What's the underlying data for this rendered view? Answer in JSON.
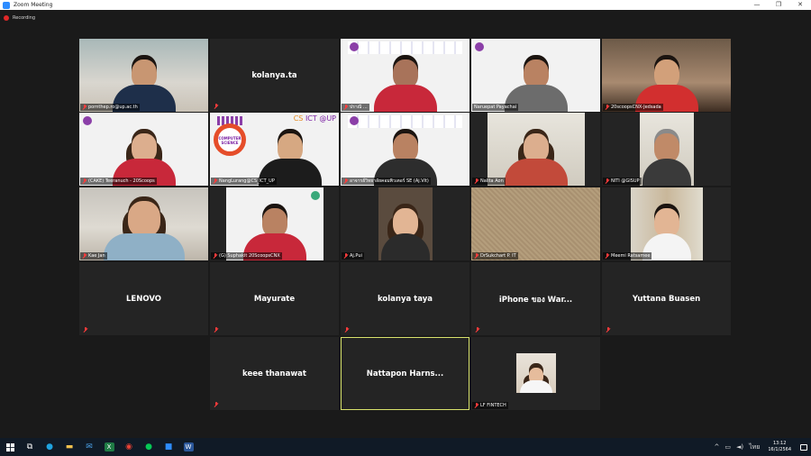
{
  "window": {
    "title": "Zoom Meeting",
    "controls": [
      "—",
      "❐",
      "✕"
    ]
  },
  "recording": {
    "label": "Recording",
    "color": "#e02828"
  },
  "active_speaker_color": "#d8e26c",
  "tiles": [
    {
      "id": "pornthep",
      "caption": "pornthep.ro@up.ac.th",
      "muted": true,
      "video": true
    },
    {
      "id": "kolanya-ta",
      "name": "kolanya.ta",
      "muted": true,
      "video": false
    },
    {
      "id": "chiangmai",
      "caption": "ปราณี ...",
      "muted": true,
      "video": true
    },
    {
      "id": "naruepat",
      "caption": "Naruepat Payachai",
      "muted": false,
      "video": true
    },
    {
      "id": "jedsada",
      "caption": "20scoopsCNX-Jedsada",
      "muted": true,
      "video": true
    },
    {
      "id": "teeranuch",
      "caption": "(CAKE) Teeranuch - 20Scoops",
      "muted": true,
      "video": true
    },
    {
      "id": "nangurang",
      "caption": "NangLurang@CS_ICT_UP",
      "muted": true,
      "video": true,
      "tag_cs": "CS",
      "tag_ict": "ICT @UP",
      "logo_text": "COMPUTER SCIENCE"
    },
    {
      "id": "ajvit",
      "caption": "อาจารย์วิทยาลัยคอมพิวเตอร์ SE (Aj.Vit)",
      "muted": true,
      "video": true
    },
    {
      "id": "nalita",
      "caption": "Nalita Aon",
      "muted": true,
      "video": true
    },
    {
      "id": "niti",
      "caption": "NITI @GISUP",
      "muted": true,
      "video": true
    },
    {
      "id": "kae-jan",
      "caption": "Kae Jan",
      "muted": true,
      "video": true
    },
    {
      "id": "suphakit",
      "caption": "(G) Suphakit 20ScoopsCNX",
      "muted": true,
      "video": true
    },
    {
      "id": "aj-pui",
      "caption": "Aj.Pui",
      "muted": true,
      "video": true
    },
    {
      "id": "sukchart",
      "caption": "DrSukchart P. IT",
      "muted": true,
      "video": true
    },
    {
      "id": "meemi",
      "caption": "Meemi Ratsamee",
      "muted": true,
      "video": true
    },
    {
      "id": "lenovo",
      "name": "LENOVO",
      "muted": true,
      "video": false
    },
    {
      "id": "mayurate",
      "name": "Mayurate",
      "muted": true,
      "video": false
    },
    {
      "id": "kolanya-taya",
      "name": "kolanya taya",
      "muted": true,
      "video": false
    },
    {
      "id": "iphone-war",
      "name": "iPhone ของ War...",
      "muted": true,
      "video": false
    },
    {
      "id": "yuttana",
      "name": "Yuttana Buasen",
      "muted": true,
      "video": false
    },
    {
      "id": "keee",
      "name": "keee thanawat",
      "muted": true,
      "video": false
    },
    {
      "id": "nattapon",
      "name": "Nattapon  Harns...",
      "muted": false,
      "video": false,
      "active": true
    },
    {
      "id": "lf-fintech",
      "caption": "LF FINTECH",
      "muted": true,
      "video": true
    }
  ],
  "taskbar": {
    "start_icon": "windows-start-icon",
    "apps": [
      {
        "name": "task-view-icon",
        "glyph": "⧉",
        "color": "#ffffff"
      },
      {
        "name": "edge-browser-icon",
        "glyph": "●",
        "color": "#1fa3e0"
      },
      {
        "name": "file-explorer-icon",
        "glyph": "▬",
        "color": "#f2c14e"
      },
      {
        "name": "mail-icon",
        "glyph": "✉",
        "color": "#4aa0e6"
      },
      {
        "name": "excel-icon",
        "glyph": "X",
        "color": "#1f7b45"
      },
      {
        "name": "chrome-icon",
        "glyph": "◉",
        "color": "#e94235"
      },
      {
        "name": "line-icon",
        "glyph": "●",
        "color": "#06c755"
      },
      {
        "name": "zoom-icon",
        "glyph": "■",
        "color": "#2d8cff"
      },
      {
        "name": "word-icon",
        "glyph": "W",
        "color": "#2b579a"
      }
    ],
    "tray": {
      "chevron": "^",
      "ime": "ไทย",
      "time": "13:12",
      "date": "16/1/2564"
    }
  }
}
